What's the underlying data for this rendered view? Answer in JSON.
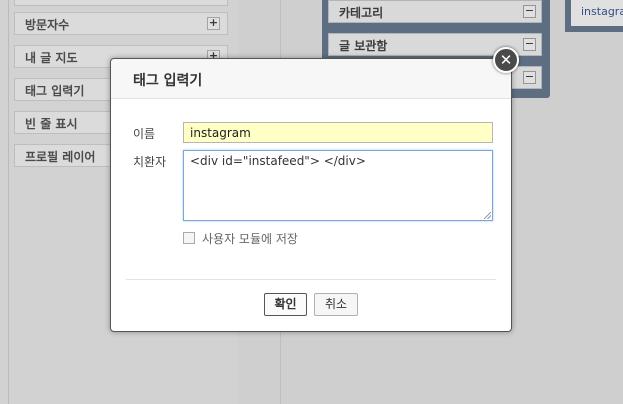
{
  "sidebar": {
    "items": [
      {
        "label": "방문자수",
        "icon": "plus-icon"
      },
      {
        "label": "내 글 지도",
        "icon": "plus-icon"
      },
      {
        "label": "태그 입력기",
        "icon": "plus-icon"
      },
      {
        "label": "빈 줄 표시",
        "icon": "plus-icon"
      },
      {
        "label": "프로필 레이어",
        "icon": "plus-icon"
      }
    ]
  },
  "active_panel": {
    "items": [
      {
        "label": "카테고리",
        "icon": "minus-icon"
      },
      {
        "label": "글 보관함",
        "icon": "minus-icon"
      },
      {
        "label": "",
        "icon": "minus-icon"
      }
    ]
  },
  "right_panel": {
    "label": "instagra"
  },
  "dialog": {
    "title": "태그 입력기",
    "close_glyph": "✕",
    "name_label": "이름",
    "name_value": "instagram",
    "replace_label": "치환자",
    "replace_value": "<div id=\"instafeed\"> </div>",
    "checkbox_label": "사용자 모듈에 저장",
    "checkbox_checked": false,
    "ok_label": "확인",
    "cancel_label": "취소"
  },
  "colors": {
    "panel_blue": "#6c7e95",
    "input_highlight": "#ffffc6",
    "focus_border": "#7aa7dc"
  }
}
